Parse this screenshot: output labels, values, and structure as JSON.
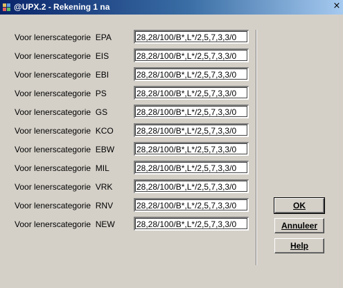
{
  "window": {
    "title": "@UPX.2 - Rekening 1 na",
    "close_glyph": "×"
  },
  "rows": [
    {
      "label": "Voor lenerscategorie",
      "code": "EPA",
      "value": "28,28/100/B*,L*/2,5,7,3,3/0"
    },
    {
      "label": "Voor lenerscategorie",
      "code": "EIS",
      "value": "28,28/100/B*,L*/2,5,7,3,3/0"
    },
    {
      "label": "Voor lenerscategorie",
      "code": "EBI",
      "value": "28,28/100/B*,L*/2,5,7,3,3/0"
    },
    {
      "label": "Voor lenerscategorie",
      "code": "PS",
      "value": "28,28/100/B*,L*/2,5,7,3,3/0"
    },
    {
      "label": "Voor lenerscategorie",
      "code": "GS",
      "value": "28,28/100/B*,L*/2,5,7,3,3/0"
    },
    {
      "label": "Voor lenerscategorie",
      "code": "KCO",
      "value": "28,28/100/B*,L*/2,5,7,3,3/0"
    },
    {
      "label": "Voor lenerscategorie",
      "code": "EBW",
      "value": "28,28/100/B*,L*/2,5,7,3,3/0"
    },
    {
      "label": "Voor lenerscategorie",
      "code": "MIL",
      "value": "28,28/100/B*,L*/2,5,7,3,3/0"
    },
    {
      "label": "Voor lenerscategorie",
      "code": "VRK",
      "value": "28,28/100/B*,L*/2,5,7,3,3/0"
    },
    {
      "label": "Voor lenerscategorie",
      "code": "RNV",
      "value": "28,28/100/B*,L*/2,5,7,3,3/0"
    },
    {
      "label": "Voor lenerscategorie",
      "code": "NEW",
      "value": "28,28/100/B*,L*/2,5,7,3,3/0"
    }
  ],
  "buttons": {
    "ok": "OK",
    "cancel": "Annuleer",
    "help": "Help"
  }
}
